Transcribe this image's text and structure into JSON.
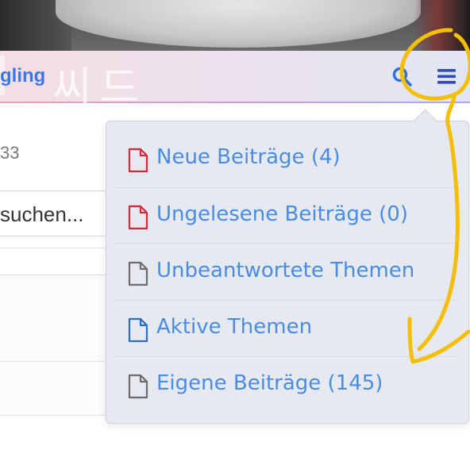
{
  "header": {
    "brand_fragment": "gling",
    "hangul_watermark": "씨드"
  },
  "background": {
    "count_fragment": "33",
    "search_fragment": "suchen..."
  },
  "dropdown": {
    "items": [
      {
        "label": "Neue Beiträge (4)",
        "icon": "file-red-icon",
        "color": "#d0293a"
      },
      {
        "label": "Ungelesene Beiträge (0)",
        "icon": "file-red-icon",
        "color": "#d0293a"
      },
      {
        "label": "Unbeantwortete Themen",
        "icon": "file-gray-icon",
        "color": "#6b6b6b"
      },
      {
        "label": "Aktive Themen",
        "icon": "file-blue-icon",
        "color": "#2a6fb8"
      },
      {
        "label": "Eigene Beiträge (145)",
        "icon": "file-gray-icon",
        "color": "#6b6b6b"
      }
    ]
  },
  "colors": {
    "link": "#4a8be3",
    "accent_blue": "#2f5fd0",
    "annotation": "#f5be00"
  }
}
